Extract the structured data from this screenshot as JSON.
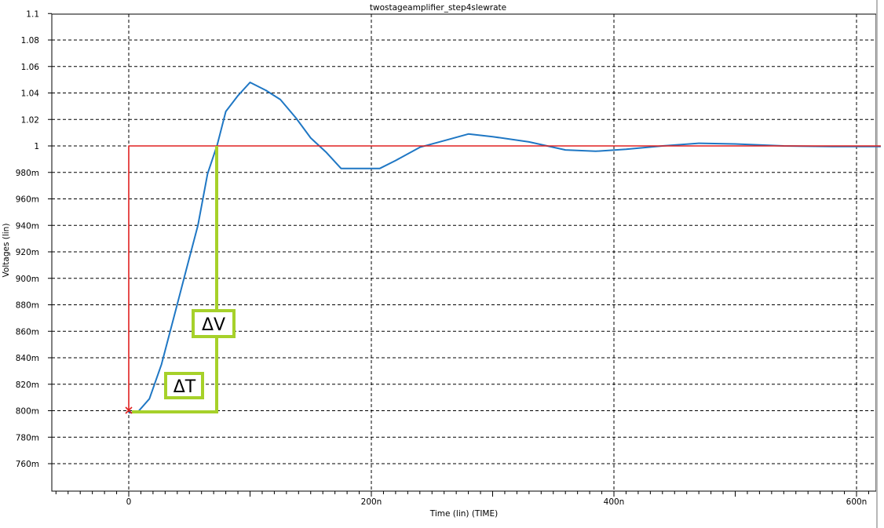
{
  "chart_data": {
    "type": "line",
    "title": "twostageamplifier_step4slewrate",
    "xlabel": "Time (lin) (TIME)",
    "ylabel": "Voltages (lin)",
    "x_unit": "s",
    "xlim": [
      -3e-07,
      6.2e-07
    ],
    "ylim": [
      0.75,
      1.1
    ],
    "x_ticks": [
      {
        "value": 0,
        "label": "0"
      },
      {
        "value": 2e-07,
        "label": "200n"
      },
      {
        "value": 4e-07,
        "label": "400n"
      },
      {
        "value": 6e-07,
        "label": "600n"
      }
    ],
    "y_ticks": [
      {
        "value": 1.1,
        "label": "1.1"
      },
      {
        "value": 1.08,
        "label": "1.08"
      },
      {
        "value": 1.06,
        "label": "1.06"
      },
      {
        "value": 1.04,
        "label": "1.04"
      },
      {
        "value": 1.02,
        "label": "1.02"
      },
      {
        "value": 1.0,
        "label": "1"
      },
      {
        "value": 0.98,
        "label": "980m"
      },
      {
        "value": 0.96,
        "label": "960m"
      },
      {
        "value": 0.94,
        "label": "940m"
      },
      {
        "value": 0.92,
        "label": "920m"
      },
      {
        "value": 0.9,
        "label": "900m"
      },
      {
        "value": 0.88,
        "label": "880m"
      },
      {
        "value": 0.86,
        "label": "860m"
      },
      {
        "value": 0.84,
        "label": "840m"
      },
      {
        "value": 0.82,
        "label": "820m"
      },
      {
        "value": 0.8,
        "label": "800m"
      },
      {
        "value": 0.78,
        "label": "780m"
      },
      {
        "value": 0.76,
        "label": "760m"
      }
    ],
    "grid": true,
    "series": [
      {
        "color": "#1f77c4",
        "x": [
          0,
          7e-09,
          1.7e-08,
          2.7e-08,
          3.7e-08,
          4.7e-08,
          5.7e-08,
          6.5e-08,
          7.3e-08,
          8e-08,
          9e-08,
          1e-07,
          1.13e-07,
          1.25e-07,
          1.38e-07,
          1.5e-07,
          1.63e-07,
          1.75e-07,
          1.9e-07,
          2.07e-07,
          2.2e-07,
          2.4e-07,
          2.6e-07,
          2.8e-07,
          3e-07,
          3.3e-07,
          3.6e-07,
          3.85e-07,
          4.1e-07,
          4.4e-07,
          4.7e-07,
          5e-07,
          5.4e-07,
          5.8e-07,
          6.2e-07
        ],
        "y": [
          0.7985,
          0.7985,
          0.809,
          0.835,
          0.87,
          0.905,
          0.94,
          0.979,
          1.001,
          1.026,
          1.038,
          1.048,
          1.042,
          1.035,
          1.021,
          1.006,
          0.995,
          0.983,
          0.983,
          0.983,
          0.989,
          0.999,
          1.004,
          1.009,
          1.007,
          1.003,
          0.997,
          0.996,
          0.9975,
          1.0,
          1.002,
          1.0015,
          1.0,
          0.9995,
          0.9995
        ]
      },
      {
        "color": "#e02020",
        "x": [
          0,
          0,
          6.2e-07
        ],
        "y": [
          0.8,
          1.0,
          1.0
        ]
      }
    ],
    "annotations": [
      {
        "label": "ΔV",
        "color": "#a6d12a"
      },
      {
        "label": "ΔT",
        "color": "#a6d12a"
      }
    ]
  },
  "colors": {
    "signal": "#1f77c4",
    "reference": "#e02020",
    "annotation": "#a6d12a"
  }
}
